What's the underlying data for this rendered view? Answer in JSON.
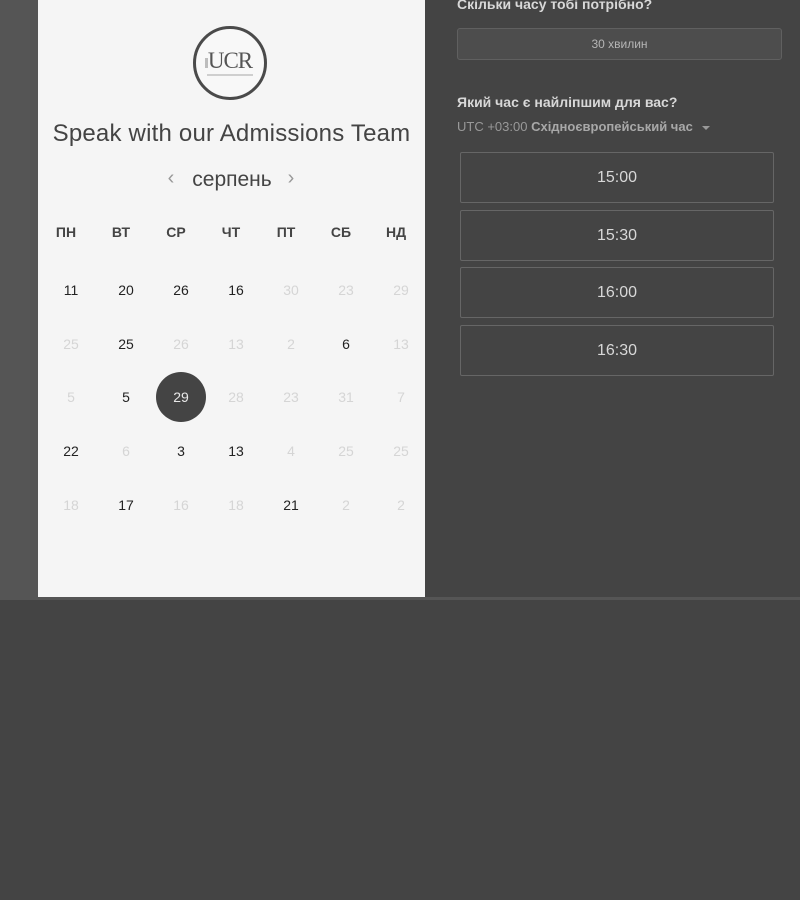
{
  "scheduler": {
    "logo_text": "UCR",
    "title": "Speak with our Admissions Team",
    "month": "серпень",
    "weekdays": [
      "ПН",
      "ВТ",
      "СР",
      "ЧТ",
      "ПТ",
      "СБ",
      "НД"
    ],
    "weeks": [
      [
        "11",
        "20",
        "26",
        "16",
        "30",
        "23",
        "29"
      ],
      [
        "25",
        "25",
        "26",
        "13",
        "2",
        "6",
        "13"
      ],
      [
        "5",
        "5",
        "29",
        "28",
        "23",
        "31",
        "7"
      ],
      [
        "22",
        "6",
        "3",
        "13",
        "4",
        "25",
        "25"
      ],
      [
        "18",
        "17",
        "16",
        "18",
        "21",
        "2",
        "2"
      ]
    ],
    "muted_days": [
      [
        4,
        5,
        6
      ],
      [
        0,
        2,
        3,
        4,
        6
      ],
      [
        0,
        3,
        4,
        5,
        6
      ],
      [
        1,
        4,
        5,
        6
      ],
      [
        0,
        2,
        3,
        5,
        6
      ]
    ],
    "selected_day": {
      "week": 2,
      "day": 2
    }
  },
  "booking": {
    "duration_heading": "Скільки часу тобі потрібно?",
    "duration_value": "30 хвилин",
    "time_heading": "Який час є найліпшим для вас?",
    "timezone_offset": "UTC +03:00",
    "timezone_name": "Східноєвропейський час",
    "time_slots": [
      "15:00",
      "15:30",
      "16:00",
      "16:30"
    ]
  },
  "colors": {
    "background": "#444444",
    "calendar_background": "#f5f5f5",
    "selected_day": "#444444",
    "muted_text": "#d5d5d5"
  },
  "icons": [
    "chevron-left-icon",
    "chevron-right-icon",
    "caret-down-icon"
  ]
}
